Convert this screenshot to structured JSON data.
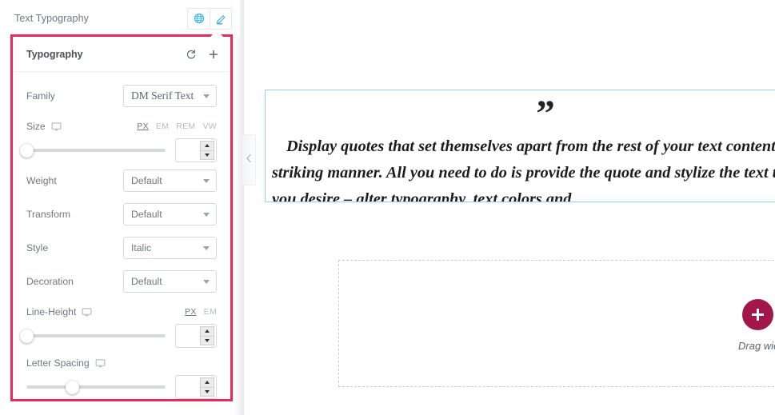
{
  "colors": {
    "highlight_border": "#E8295A",
    "widget_selection": "#8ED4EC",
    "accent_blue": "#39B5E5",
    "add_button": "#A2174A",
    "template_button": "#6D7882",
    "label_text": "#6D7882"
  },
  "section_header": {
    "title": "Text Typography",
    "mode_buttons": [
      {
        "name": "globe-icon",
        "label": "Global"
      },
      {
        "name": "pencil-icon",
        "label": "Edit"
      }
    ]
  },
  "panel": {
    "title": "Typography",
    "actions": [
      {
        "name": "reset-icon",
        "label": "Reset"
      },
      {
        "name": "plus-icon",
        "label": "Add"
      }
    ],
    "controls": {
      "family": {
        "label": "Family",
        "value": "DM Serif Text"
      },
      "size": {
        "label": "Size",
        "device": "desktop",
        "units": [
          "PX",
          "EM",
          "REM",
          "VW"
        ],
        "active_unit": "PX",
        "slider_percent": 0,
        "value": ""
      },
      "weight": {
        "label": "Weight",
        "value": "Default"
      },
      "transform": {
        "label": "Transform",
        "value": "Default"
      },
      "style": {
        "label": "Style",
        "value": "Italic"
      },
      "decoration": {
        "label": "Decoration",
        "value": "Default"
      },
      "line_height": {
        "label": "Line-Height",
        "device": "desktop",
        "units": [
          "PX",
          "EM"
        ],
        "active_unit": "PX",
        "slider_percent": 0,
        "value": ""
      },
      "letter_spacing": {
        "label": "Letter Spacing",
        "device": "desktop",
        "units": [],
        "active_unit": "",
        "slider_percent": 33,
        "value": ""
      }
    }
  },
  "collapse_handle": {
    "name": "chevron-left-icon"
  },
  "canvas": {
    "quote_widget": {
      "quote_mark": "”",
      "text": "Display quotes that set themselves apart from the rest of your text content in a striking manner. All you need to do is provide the quote and stylize the text the way you desire – alter typography, text colors and"
    },
    "dropzone": {
      "add_button_label": "+",
      "drag_label": "Drag widget here"
    }
  }
}
